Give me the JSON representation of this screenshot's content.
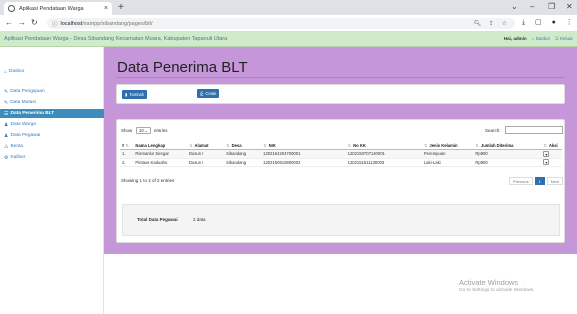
{
  "browser": {
    "tab_title": "Aplikasi Pendataan Warga",
    "tab_close": "×",
    "new_tab": "+",
    "url_host": "localhost",
    "url_path": "/xampp/sibandang/pages/blt/",
    "controls": {
      "minimize": "⌄",
      "min2": "–",
      "max": "❐",
      "close": "✕"
    }
  },
  "header": {
    "brand": "Aplikasi Pendataan Warga - Desa Sibandang Kecamatan Muara, Kabupaten Tapanuli Utara",
    "greeting": "Hai, admin",
    "dashboard_link": "Dasbor",
    "logout_link": "Keluar"
  },
  "sidebar": {
    "items": [
      {
        "icon": "home-icon",
        "glyph": "⌂",
        "label": "Dasbor",
        "active": false
      },
      {
        "icon": "user-edit-icon",
        "glyph": "✎",
        "label": "Data Pengajuan",
        "active": false
      },
      {
        "icon": "user-move-icon",
        "glyph": "✎",
        "label": "Data Mutasi",
        "active": false
      },
      {
        "icon": "list-icon",
        "glyph": "☰",
        "label": "Data Penerima BLT",
        "active": true
      },
      {
        "icon": "users-icon",
        "glyph": "♟",
        "label": "Data Warga",
        "active": false
      },
      {
        "icon": "users-icon",
        "glyph": "♟",
        "label": "Data Pegawai",
        "active": false
      },
      {
        "icon": "news-icon",
        "glyph": "⚠",
        "label": "Berita",
        "active": false
      },
      {
        "icon": "gear-icon",
        "glyph": "⚙",
        "label": "Kaliber",
        "active": false
      }
    ]
  },
  "page": {
    "title": "Data Penerima BLT",
    "add_button": "Tambah",
    "print_button": "Cetak"
  },
  "table": {
    "show_label": "Show",
    "entries_value": "10",
    "entries_label": "entries",
    "search_label": "Search:",
    "columns": [
      "#",
      "Nama Lengkap",
      "Alamat",
      "Desa",
      "NIK",
      "No KK",
      "Jenis Kelamin",
      "Jumlah Diterima",
      "Aksi"
    ],
    "rows": [
      [
        "1.",
        "Rismanlur Siregar",
        "Dusun I",
        "Sibandang",
        "1202154204700001",
        "1202150707140001",
        "Perempuan",
        "Rp900"
      ],
      [
        "2.",
        "Pintaus Kaduaho",
        "Dusun I",
        "Sibandang",
        "1202150610880002",
        "1202151611130003",
        "Laki-Laki",
        "Rp900"
      ]
    ],
    "info": "Showing 1 to 2 of 2 entries",
    "pager": {
      "prev": "Previous",
      "current": "1",
      "next": "Next"
    },
    "action_glyph": "▾"
  },
  "summary": {
    "label": "Total Data Pegawai",
    "value": "2 data"
  },
  "watermark": {
    "line1": "Activate Windows",
    "line2": "Go to Settings to activate Windows."
  },
  "colors": {
    "content_bg": "#c597d9",
    "header_bg": "#d0ebca",
    "active_nav": "#3c8dbc",
    "button": "#2f6fae"
  }
}
